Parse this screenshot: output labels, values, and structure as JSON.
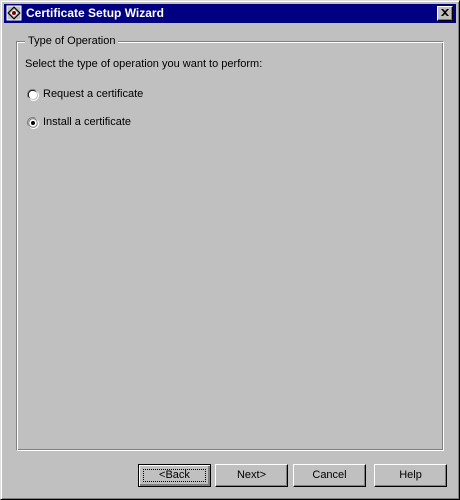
{
  "window": {
    "title": "Certificate Setup Wizard"
  },
  "titlebar": {
    "app_icon": "certificate-wizard-icon",
    "close_icon": "close-icon"
  },
  "group": {
    "legend": "Type of Operation",
    "instruction": "Select the type of operation you want to perform:",
    "options": [
      {
        "label": "Request a certificate",
        "selected": false
      },
      {
        "label": "Install a certificate",
        "selected": true
      }
    ]
  },
  "buttons": {
    "back": "<Back",
    "next": "Next>",
    "cancel": "Cancel",
    "help": "Help"
  },
  "colors": {
    "titlebar": "#000080",
    "face": "#c0c0c0"
  }
}
